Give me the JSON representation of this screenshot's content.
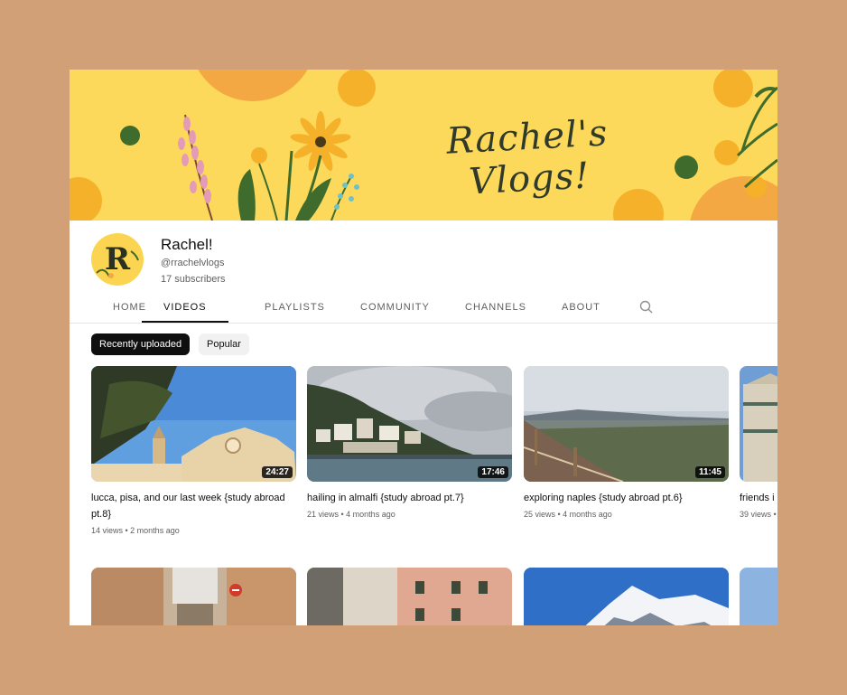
{
  "channel": {
    "banner_title": "Rachel's Vlogs!",
    "avatar_letter": "R",
    "name": "Rachel!",
    "handle": "@rrachelvlogs",
    "subscribers": "17 subscribers"
  },
  "tabs": [
    {
      "label": "HOME"
    },
    {
      "label": "VIDEOS",
      "active": true
    },
    {
      "label": "PLAYLISTS"
    },
    {
      "label": "COMMUNITY"
    },
    {
      "label": "CHANNELS"
    },
    {
      "label": "ABOUT"
    }
  ],
  "chips": [
    {
      "label": "Recently uploaded",
      "active": true
    },
    {
      "label": "Popular"
    }
  ],
  "videos": [
    {
      "title": "lucca, pisa, and our last week {study abroad pt.8}",
      "duration": "24:27",
      "views": "14 views",
      "age": "2 months ago"
    },
    {
      "title": "hailing in almalfi {study abroad pt.7}",
      "duration": "17:46",
      "views": "21 views",
      "age": "4 months ago"
    },
    {
      "title": "exploring naples {study abroad pt.6}",
      "duration": "11:45",
      "views": "25 views",
      "age": "4 months ago"
    },
    {
      "title": "friends i",
      "views": "39 views",
      "age": "•"
    }
  ],
  "icons": {
    "search": "search-icon"
  },
  "colors": {
    "banner": "#fcd95a",
    "background": "#d1a077",
    "accent_text": "#0f0f0f"
  }
}
